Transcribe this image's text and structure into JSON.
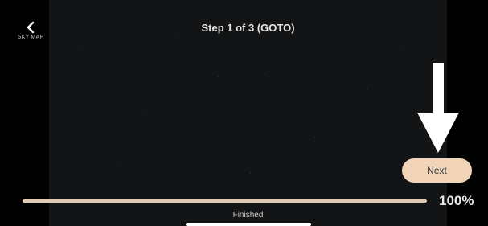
{
  "nav": {
    "back_label": "SKY MAP",
    "back_icon": "chevron-left-icon"
  },
  "header": {
    "title": "Step 1 of 3 (GOTO)"
  },
  "annotation": {
    "icon": "down-arrow-icon",
    "color": "#ffffff"
  },
  "actions": {
    "next_label": "Next",
    "next_color": "#f2d5b9"
  },
  "progress": {
    "value": 1.0,
    "percent_label": "100%",
    "status_text": "Finished",
    "fill_color": "#e1cbb5"
  }
}
